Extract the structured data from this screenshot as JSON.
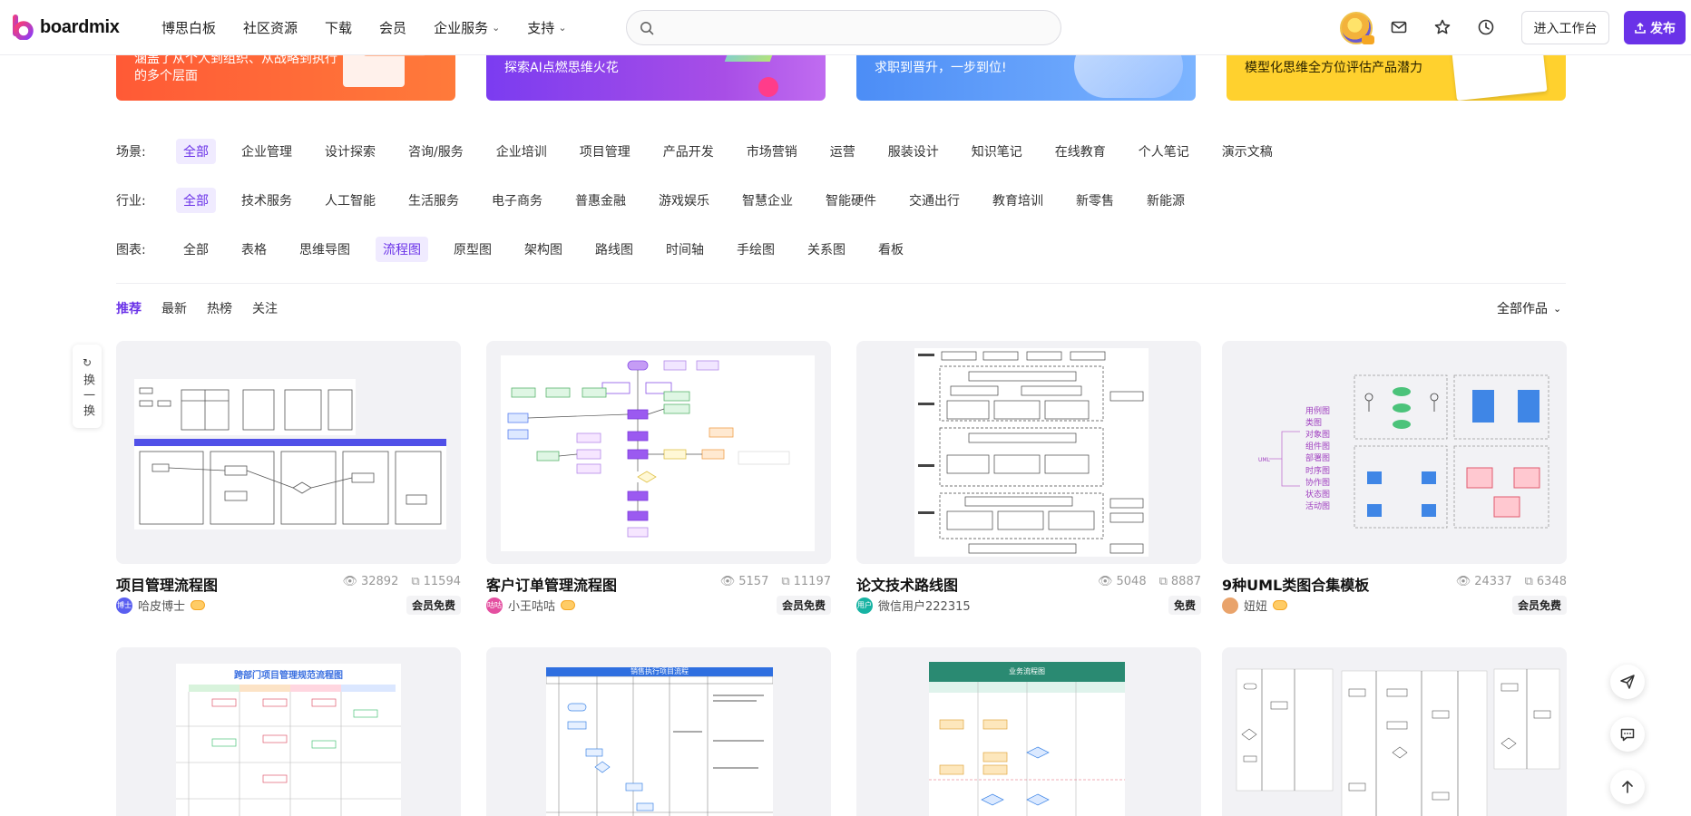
{
  "brand": {
    "name": "boardmix"
  },
  "nav": [
    {
      "label": "博思白板",
      "has_menu": false
    },
    {
      "label": "社区资源",
      "has_menu": false
    },
    {
      "label": "下载",
      "has_menu": false
    },
    {
      "label": "会员",
      "has_menu": false
    },
    {
      "label": "企业服务",
      "has_menu": true
    },
    {
      "label": "支持",
      "has_menu": true
    }
  ],
  "search": {
    "placeholder": ""
  },
  "header_actions": {
    "workbench": "进入工作台",
    "publish": "发布"
  },
  "banners": [
    {
      "text": "涵盖了从个人到组织、从战略到执行的多个层面",
      "color": "#ff5a36"
    },
    {
      "text": "探索AI点燃思维火花",
      "color": "#8a3ff0"
    },
    {
      "text": "求职到晋升，一步到位!",
      "color": "#4c8df6"
    },
    {
      "text": "模型化思维全方位评估产品潜力",
      "color": "#ffd12e"
    }
  ],
  "filters": {
    "scene": {
      "label": "场景:",
      "active_index": 0,
      "options": [
        "全部",
        "企业管理",
        "设计探索",
        "咨询/服务",
        "企业培训",
        "项目管理",
        "产品开发",
        "市场营销",
        "运营",
        "服装设计",
        "知识笔记",
        "在线教育",
        "个人笔记",
        "演示文稿"
      ]
    },
    "industry": {
      "label": "行业:",
      "active_index": 0,
      "options": [
        "全部",
        "技术服务",
        "人工智能",
        "生活服务",
        "电子商务",
        "普惠金融",
        "游戏娱乐",
        "智慧企业",
        "智能硬件",
        "交通出行",
        "教育培训",
        "新零售",
        "新能源"
      ]
    },
    "chart": {
      "label": "图表:",
      "active_index": 3,
      "options": [
        "全部",
        "表格",
        "思维导图",
        "流程图",
        "原型图",
        "架构图",
        "路线图",
        "时间轴",
        "手绘图",
        "关系图",
        "看板"
      ]
    }
  },
  "sort": {
    "tabs": [
      "推荐",
      "最新",
      "热榜",
      "关注"
    ],
    "active_index": 0,
    "scope": "全部作品"
  },
  "refresh": {
    "label": "换一换"
  },
  "cards": [
    {
      "title": "项目管理流程图",
      "views": "32892",
      "copies": "11594",
      "author": "哈皮博士",
      "avatar_text": "博士",
      "avatar_color": "#5a5ff0",
      "vip": true,
      "price": "会员免费"
    },
    {
      "title": "客户订单管理流程图",
      "views": "5157",
      "copies": "11197",
      "author": "小王咕咕",
      "avatar_text": "咕咕",
      "avatar_color": "#e44fa0",
      "vip": true,
      "price": "会员免费"
    },
    {
      "title": "论文技术路线图",
      "views": "5048",
      "copies": "8887",
      "author": "微信用户222315",
      "avatar_text": "用户",
      "avatar_color": "#17b3a3",
      "vip": false,
      "price": "免费"
    },
    {
      "title": "9种UML类图合集模板",
      "views": "24337",
      "copies": "6348",
      "author": "妞妞",
      "avatar_text": "",
      "avatar_color": "#e9a36b",
      "vip": true,
      "price": "会员免费"
    }
  ],
  "card_row2_headers": [
    "跨部门项目管理规范流程图",
    "销售执行项目流程",
    "业务流程图"
  ],
  "icons": {
    "search": "search-icon",
    "mail": "mail-icon",
    "star": "star-icon",
    "history": "clock-icon",
    "publish": "upload-icon",
    "views": "eye-icon",
    "copies": "copy-icon",
    "share": "share-icon",
    "chat": "chat-icon",
    "top": "arrow-up-icon"
  },
  "colors": {
    "accent": "#6a32e8",
    "accent_bg": "#f0ebff"
  }
}
